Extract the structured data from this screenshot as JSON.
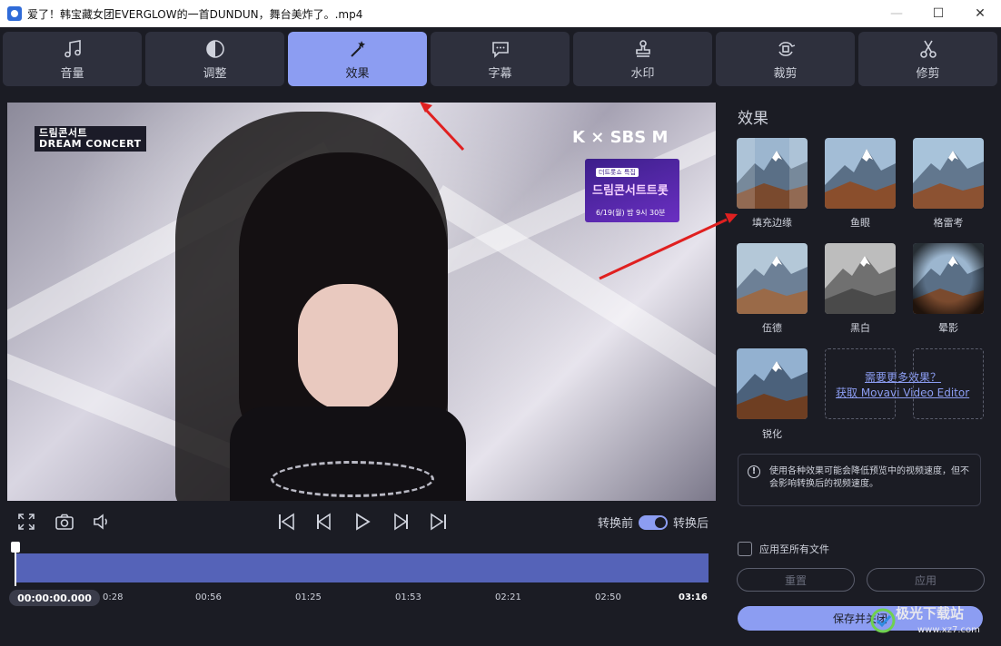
{
  "window": {
    "title": "爱了！韩宝藏女团EVERGLOW的一首DUNDUN，舞台美炸了。.mp4",
    "controls": [
      "—",
      "☐",
      "✕"
    ]
  },
  "tabs": [
    {
      "label": "音量",
      "icon": "music-note-icon",
      "active": false
    },
    {
      "label": "调整",
      "icon": "contrast-icon",
      "active": false
    },
    {
      "label": "效果",
      "icon": "magic-wand-icon",
      "active": true
    },
    {
      "label": "字幕",
      "icon": "speech-bubble-icon",
      "active": false
    },
    {
      "label": "水印",
      "icon": "stamp-icon",
      "active": false
    },
    {
      "label": "裁剪",
      "icon": "rotate-crop-icon",
      "active": false
    },
    {
      "label": "修剪",
      "icon": "scissors-icon",
      "active": false
    }
  ],
  "video": {
    "logo_left_line1": "드림콘서트",
    "logo_left_line2": "DREAM CONCERT",
    "logo_right": "K × SBS M",
    "promo_line1": "더트롯쇼 특집",
    "promo_line2": "드림콘서트트롯",
    "promo_line3": "6/19(월) 밤 9시 30분"
  },
  "player": {
    "toggle_before": "转换前",
    "toggle_after": "转换后",
    "toggle_on": true
  },
  "timeline": {
    "current_time": "00:00:00.000",
    "ticks": [
      "0:28",
      "00:56",
      "01:25",
      "01:53",
      "02:21",
      "02:50",
      "03:16"
    ],
    "position_fraction": 0
  },
  "effects_panel": {
    "title": "效果",
    "effects": [
      {
        "label": "填充边缘",
        "icon": "mountain-thumbnail"
      },
      {
        "label": "鱼眼",
        "icon": "mountain-thumbnail"
      },
      {
        "label": "格雷考",
        "icon": "mountain-thumbnail"
      },
      {
        "label": "伍德",
        "icon": "mountain-thumbnail"
      },
      {
        "label": "黑白",
        "icon": "mountain-thumbnail"
      },
      {
        "label": "晕影",
        "icon": "mountain-thumbnail"
      },
      {
        "label": "锐化",
        "icon": "mountain-thumbnail"
      }
    ],
    "more_line1": "需要更多效果？",
    "more_line2": "获取 Movavi Video Editor",
    "notice": "使用各种效果可能会降低预览中的视频速度，但不会影响转换后的视频速度。",
    "apply_all_label": "应用至所有文件",
    "apply_all_checked": false,
    "reset_label": "重置",
    "apply_label": "应用",
    "save_close_label": "保存并关闭"
  },
  "watermark": {
    "text": "极光下载站",
    "url": "www.xz7.com"
  },
  "colors": {
    "background": "#1b1c24",
    "tab": "#2e303d",
    "accent": "#8c9df2",
    "timeline": "#5563b8",
    "annotation_arrow": "#e02020"
  }
}
